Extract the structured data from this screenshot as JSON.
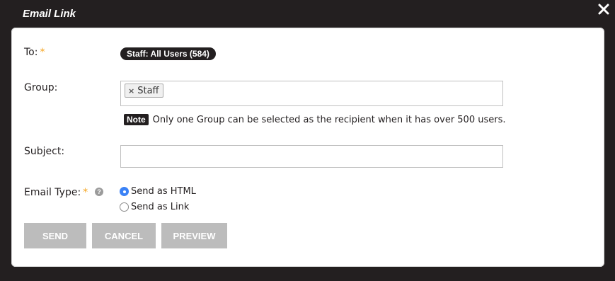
{
  "dialog": {
    "title": "Email Link",
    "close_icon": "close-icon"
  },
  "form": {
    "to": {
      "label": "To:",
      "required_mark": "*",
      "recipient": "Staff: All Users (584)"
    },
    "group": {
      "label": "Group:",
      "chips": [
        {
          "remove_glyph": "×",
          "text": "Staff"
        }
      ],
      "note_tag": "Note",
      "note_text": "Only one Group can be selected as the recipient when it has over 500 users."
    },
    "subject": {
      "label": "Subject:",
      "value": ""
    },
    "email_type": {
      "label": "Email Type:",
      "required_mark": "*",
      "help_glyph": "?",
      "options": [
        {
          "label": "Send as HTML",
          "checked": true
        },
        {
          "label": "Send as Link",
          "checked": false
        }
      ]
    }
  },
  "actions": {
    "send": "SEND",
    "cancel": "CANCEL",
    "preview": "PREVIEW"
  },
  "colors": {
    "background": "#231f20",
    "panel": "#ffffff",
    "required": "#f5a623",
    "radio_selected": "#3b82f6",
    "button": "#bcbcbc"
  }
}
